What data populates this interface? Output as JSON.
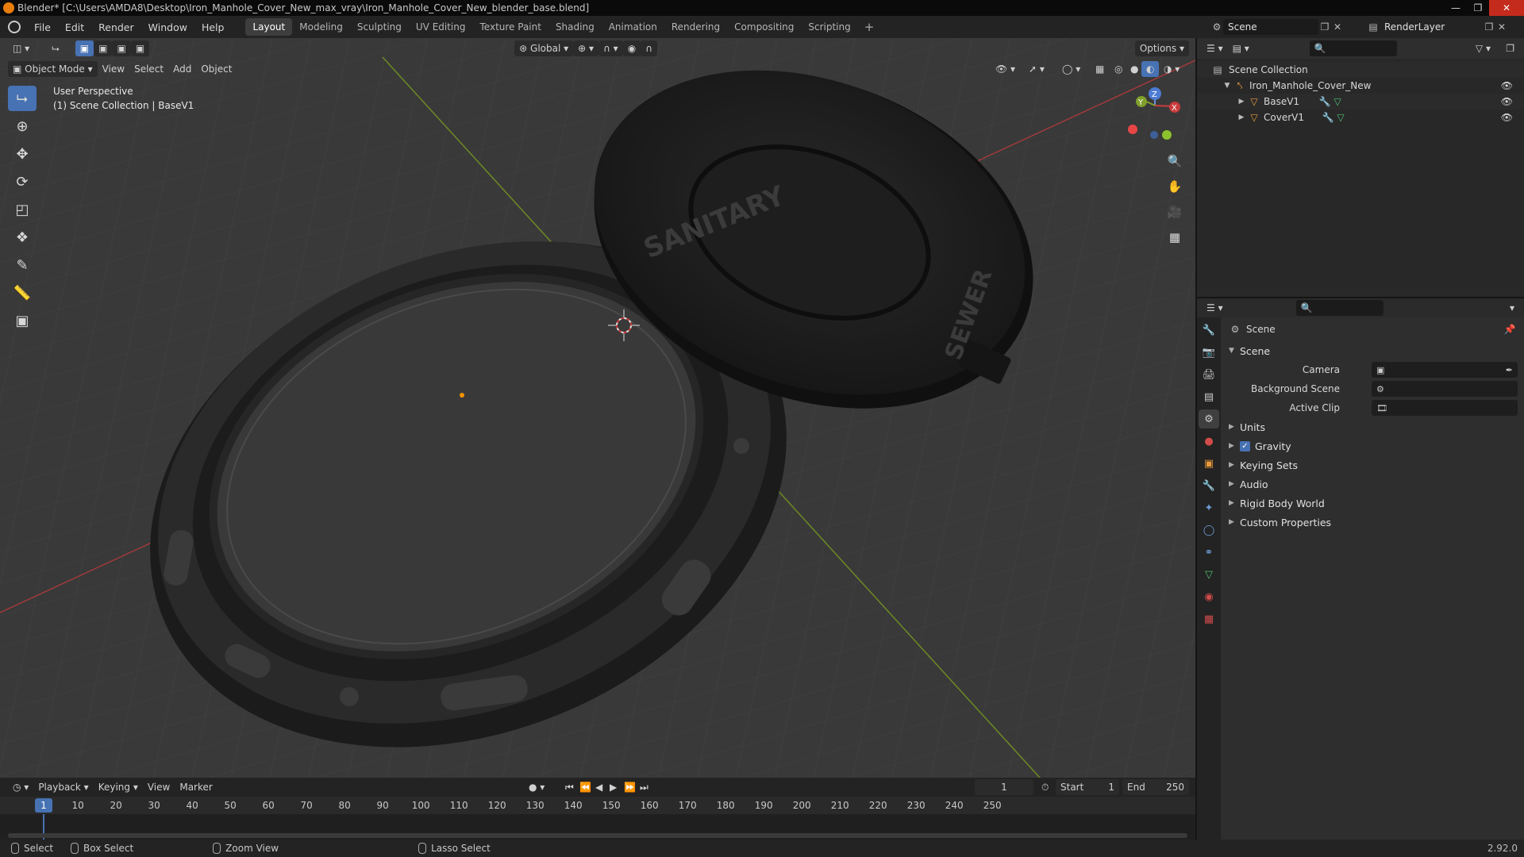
{
  "titlebar": {
    "title": "Blender* [C:\\Users\\AMDA8\\Desktop\\Iron_Manhole_Cover_New_max_vray\\Iron_Manhole_Cover_New_blender_base.blend]"
  },
  "menu": [
    "File",
    "Edit",
    "Render",
    "Window",
    "Help"
  ],
  "workspaces": [
    {
      "label": "Layout",
      "active": true
    },
    {
      "label": "Modeling"
    },
    {
      "label": "Sculpting"
    },
    {
      "label": "UV Editing"
    },
    {
      "label": "Texture Paint"
    },
    {
      "label": "Shading"
    },
    {
      "label": "Animation"
    },
    {
      "label": "Rendering"
    },
    {
      "label": "Compositing"
    },
    {
      "label": "Scripting"
    }
  ],
  "scene_selector": {
    "value": "Scene"
  },
  "renderlayer_selector": {
    "value": "RenderLayer"
  },
  "viewport": {
    "transform_orientation": "Global",
    "options_label": "Options",
    "mode": "Object Mode",
    "header_menus": [
      "View",
      "Select",
      "Add",
      "Object"
    ],
    "overlay_line1": "User Perspective",
    "overlay_line2": "(1) Scene Collection | BaseV1",
    "object_text_1": "SANITARY",
    "object_text_2": "SEWER"
  },
  "outliner": {
    "root": "Scene Collection",
    "collection": "Iron_Manhole_Cover_New",
    "objects": [
      "BaseV1",
      "CoverV1"
    ]
  },
  "properties": {
    "context": "Scene",
    "section": "Scene",
    "fields": [
      {
        "label": "Camera",
        "value": ""
      },
      {
        "label": "Background Scene",
        "value": ""
      },
      {
        "label": "Active Clip",
        "value": ""
      }
    ],
    "panels": [
      "Units",
      "Gravity",
      "Keying Sets",
      "Audio",
      "Rigid Body World",
      "Custom Properties"
    ]
  },
  "timeline": {
    "menus": [
      "Playback",
      "Keying",
      "View",
      "Marker"
    ],
    "current_frame": "1",
    "start_label": "Start",
    "start_value": "1",
    "end_label": "End",
    "end_value": "250",
    "ruler": [
      "1",
      "10",
      "20",
      "30",
      "40",
      "50",
      "60",
      "70",
      "80",
      "90",
      "100",
      "110",
      "120",
      "130",
      "140",
      "150",
      "160",
      "170",
      "180",
      "190",
      "200",
      "210",
      "220",
      "230",
      "240",
      "250"
    ]
  },
  "statusbar": {
    "items": [
      "Select",
      "Box Select",
      "Zoom View",
      "Lasso Select"
    ],
    "version": "2.92.0"
  },
  "colors": {
    "accent": "#4772b3",
    "x_axis": "#c93c3c",
    "y_axis": "#7fa02a",
    "viewport_bg": "#393939"
  }
}
